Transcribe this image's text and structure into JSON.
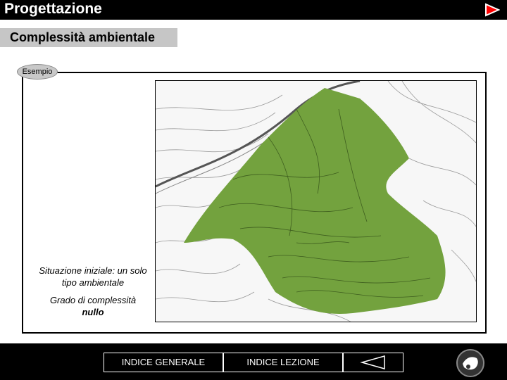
{
  "header": {
    "title": "Progettazione",
    "next_icon": "play-triangle-icon",
    "accent_color": "#ff0000"
  },
  "section": {
    "subtitle": "Complessità ambientale",
    "badge": "Esempio"
  },
  "figure": {
    "map_fill_color": "#73a23e",
    "caption_line1": "Situazione iniziale: un solo tipo ambientale",
    "caption_prefix": "Grado di complessità",
    "caption_value": "nullo"
  },
  "footer": {
    "general_index": "INDICE GENERALE",
    "lesson_index": "INDICE LEZIONE",
    "back_icon": "left-triangle-icon",
    "logo_icon": "university-logo-icon"
  }
}
